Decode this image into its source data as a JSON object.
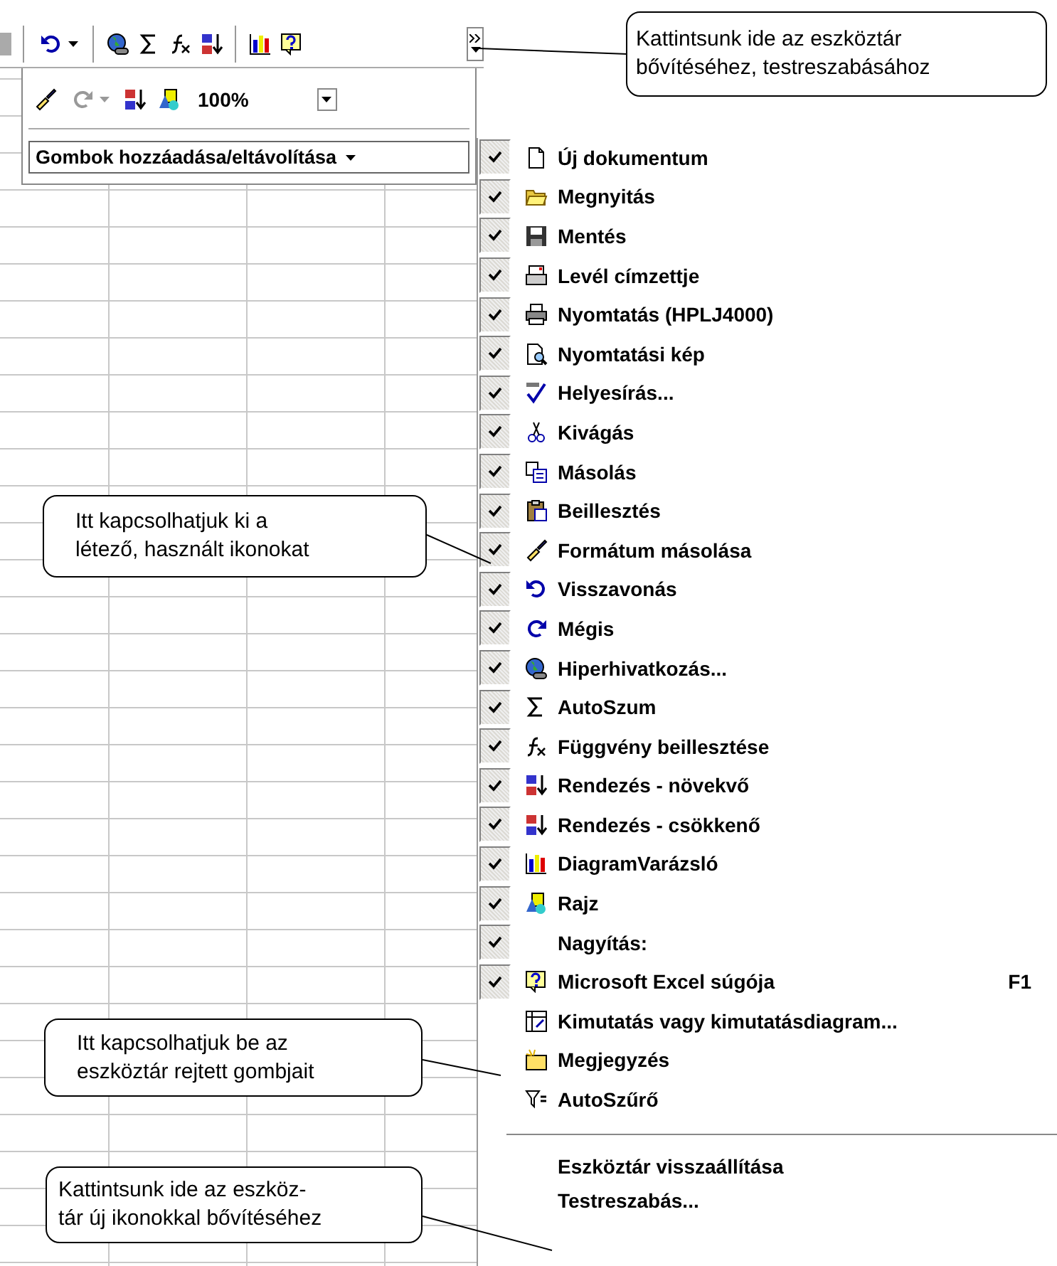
{
  "toolbar": {
    "zoom": "100%",
    "add_remove_button": "Gombok hozzáadása/eltávolítása"
  },
  "callouts": [
    {
      "lines": [
        "Kattintsunk ide az eszköztár",
        "bővítéséhez, testreszabásához"
      ]
    },
    {
      "lines": [
        "Itt kapcsolhatjuk ki a",
        "létező, használt ikonokat"
      ]
    },
    {
      "lines": [
        "Itt kapcsolhatjuk be az",
        "eszköztár rejtett gombjait"
      ]
    },
    {
      "lines": [
        "Kattintsunk ide az eszköz-",
        "tár új ikonokkal bővítéséhez"
      ]
    }
  ],
  "menu": {
    "items": [
      {
        "kind": "toggle",
        "label": "Új dokumentum",
        "checked": true
      },
      {
        "kind": "toggle",
        "label": "Megnyitás",
        "checked": true
      },
      {
        "kind": "toggle",
        "label": "Mentés",
        "checked": true
      },
      {
        "kind": "toggle",
        "label": "Levél címzettje",
        "checked": true
      },
      {
        "kind": "toggle",
        "label": "Nyomtatás (HPLJ4000)",
        "checked": true
      },
      {
        "kind": "toggle",
        "label": "Nyomtatási kép",
        "checked": true
      },
      {
        "kind": "toggle",
        "label": "Helyesírás...",
        "checked": true
      },
      {
        "kind": "toggle",
        "label": "Kivágás",
        "checked": true
      },
      {
        "kind": "toggle",
        "label": "Másolás",
        "checked": true
      },
      {
        "kind": "toggle",
        "label": "Beillesztés",
        "checked": true
      },
      {
        "kind": "toggle",
        "label": "Formátum másolása",
        "checked": true
      },
      {
        "kind": "toggle",
        "label": "Visszavonás",
        "checked": true
      },
      {
        "kind": "toggle",
        "label": "Mégis",
        "checked": true
      },
      {
        "kind": "toggle",
        "label": "Hiperhivatkozás...",
        "checked": true
      },
      {
        "kind": "toggle",
        "label": "AutoSzum",
        "checked": true
      },
      {
        "kind": "toggle",
        "label": "Függvény beillesztése",
        "checked": true
      },
      {
        "kind": "toggle",
        "label": "Rendezés - növekvő",
        "checked": true
      },
      {
        "kind": "toggle",
        "label": "Rendezés - csökkenő",
        "checked": true
      },
      {
        "kind": "toggle",
        "label": "DiagramVarázsló",
        "checked": true
      },
      {
        "kind": "toggle",
        "label": "Rajz",
        "checked": true
      },
      {
        "kind": "toggle",
        "label": "Nagyítás:",
        "checked": true
      },
      {
        "kind": "toggle",
        "label": "Microsoft Excel súgója",
        "checked": true,
        "shortcut": "F1"
      },
      {
        "kind": "toggle",
        "label": "Kimutatás vagy kimutatásdiagram...",
        "checked": false
      },
      {
        "kind": "toggle",
        "label": "Megjegyzés",
        "checked": false
      },
      {
        "kind": "toggle",
        "label": "AutoSzűrő",
        "checked": false
      },
      {
        "kind": "separator"
      },
      {
        "kind": "command",
        "label": "Eszköztár visszaállítása"
      },
      {
        "kind": "command",
        "label": "Testreszabás..."
      }
    ]
  }
}
